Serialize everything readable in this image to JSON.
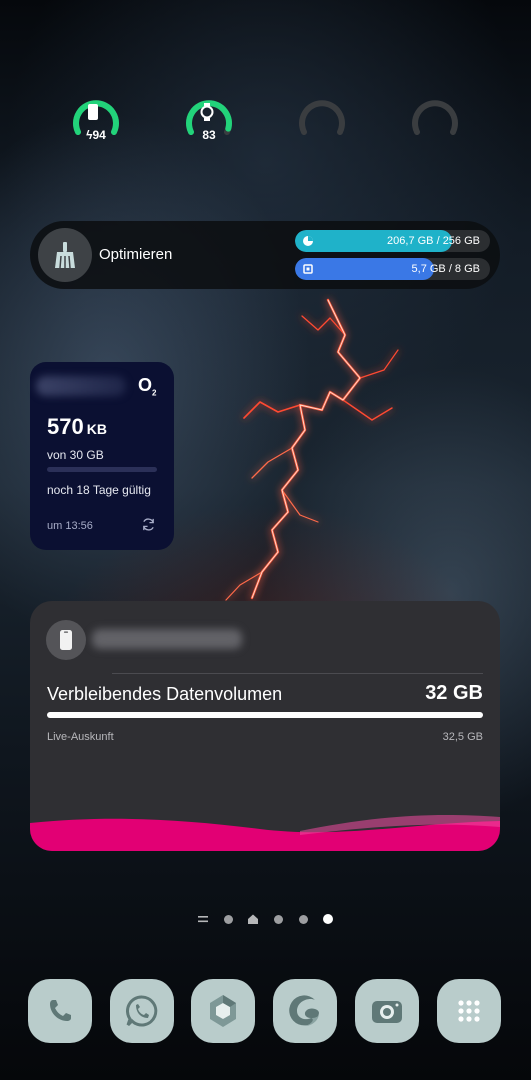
{
  "gauges": [
    {
      "icon": "phone-battery-icon",
      "value": "94",
      "charging": true,
      "level": 0.94,
      "color": "#22d37a"
    },
    {
      "icon": "watch-battery-icon",
      "value": "83",
      "charging": false,
      "level": 0.83,
      "color": "#22d37a"
    },
    {
      "icon": "empty-gauge-icon",
      "value": "",
      "level": 0
    },
    {
      "icon": "empty-gauge-icon",
      "value": "",
      "level": 0
    }
  ],
  "optimize": {
    "label": "Optimieren",
    "storage": {
      "text": "206,7 GB / 256 GB",
      "fraction": 0.807,
      "color": "#1fb2c9",
      "icon": "storage-pie-icon"
    },
    "memory": {
      "text": "5,7 GB / 8 GB",
      "fraction": 0.7125,
      "color": "#3a78e6",
      "icon": "ram-chip-icon"
    }
  },
  "o2": {
    "logo": "O",
    "logo_sub": "2",
    "amount": "570",
    "unit": "KB",
    "of_total": "von 30 GB",
    "validity": "noch 18 Tage gültig",
    "time": "um 13:56",
    "used_fraction": 0.0
  },
  "telekom": {
    "title": "Verbleibendes Datenvolumen",
    "remaining": "32 GB",
    "live_label": "Live-Auskunft",
    "total": "32,5 GB",
    "remaining_fraction": 0.985,
    "accent": "#e20074"
  },
  "pager": {
    "pages": 6,
    "active_index": 5
  },
  "dock": [
    {
      "name": "phone-app",
      "icon": "phone-icon"
    },
    {
      "name": "whatsapp-app",
      "icon": "whatsapp-icon"
    },
    {
      "name": "office-app",
      "icon": "office-icon"
    },
    {
      "name": "edge-app",
      "icon": "edge-icon"
    },
    {
      "name": "camera-app",
      "icon": "camera-icon"
    },
    {
      "name": "app-drawer",
      "icon": "apps-grid-icon"
    }
  ]
}
